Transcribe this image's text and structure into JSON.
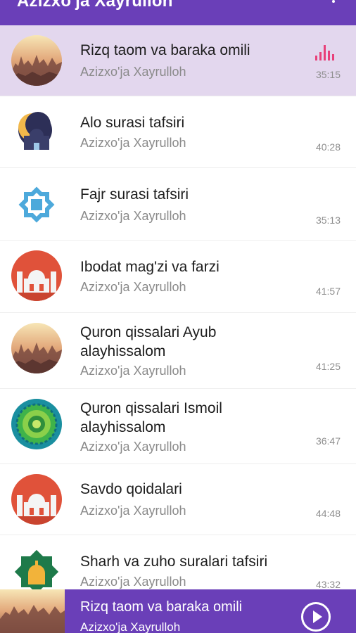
{
  "app": {
    "title": "Azizxo'ja Xayrulloh",
    "menu_icon": "more-vert-icon"
  },
  "tracks": [
    {
      "title": "Rizq taom va baraka omili",
      "author": "Azizxo'ja Xayrulloh",
      "duration": "35:15",
      "thumb": "sunset-city-thumb",
      "playing": true
    },
    {
      "title": "Alo surasi tafsiri",
      "author": "Azizxo'ja Xayrulloh",
      "duration": "40:28",
      "thumb": "mosque-moon-thumb",
      "playing": false
    },
    {
      "title": "Fajr surasi tafsiri",
      "author": "Azizxo'ja Xayrulloh",
      "duration": "35:13",
      "thumb": "star-ornament-thumb",
      "playing": false
    },
    {
      "title": "Ibodat mag'zi va farzi",
      "author": "Azizxo'ja Xayrulloh",
      "duration": "41:57",
      "thumb": "red-mosque-thumb",
      "playing": false
    },
    {
      "title": "Quron qissalari Ayub alayhissalom",
      "author": "Azizxo'ja Xayrulloh",
      "duration": "41:25",
      "thumb": "sunset-city-thumb",
      "playing": false
    },
    {
      "title": "Quron qissalari Ismoil alayhissalom",
      "author": "Azizxo'ja Xayrulloh",
      "duration": "36:47",
      "thumb": "green-pattern-thumb",
      "playing": false
    },
    {
      "title": "Savdo qoidalari",
      "author": "Azizxo'ja Xayrulloh",
      "duration": "44:48",
      "thumb": "red-mosque-thumb",
      "playing": false
    },
    {
      "title": "Sharh va zuho suralari tafsiri",
      "author": "Azizxo'ja Xayrulloh",
      "duration": "43:32",
      "thumb": "gold-mosque-star-thumb",
      "playing": false
    }
  ],
  "player": {
    "title": "Rizq taom va baraka omili",
    "author": "Azizxo'ja Xayrulloh",
    "button_icon": "play-icon"
  },
  "colors": {
    "accent": "#6a3fb8",
    "active_row": "#e3d7ee",
    "equalizer": "#e8407a"
  }
}
